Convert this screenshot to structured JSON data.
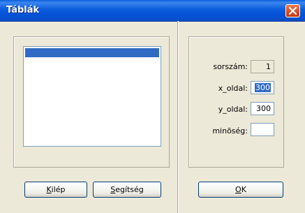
{
  "window": {
    "title": "Táblák",
    "close_icon": "close-icon"
  },
  "list": {
    "items": [
      ""
    ]
  },
  "form": {
    "sorszam": {
      "label": "sorszám:",
      "value": "1"
    },
    "x_oldal": {
      "label": "x_oldal:",
      "value": "300"
    },
    "y_oldal": {
      "label": "y_oldal:",
      "value": "300"
    },
    "minoseg": {
      "label": "minõség:",
      "value": ""
    }
  },
  "buttons": {
    "kilep": {
      "mnemonic": "K",
      "rest": "ilép"
    },
    "segitseg": {
      "mnemonic": "S",
      "rest": "egítség"
    },
    "ok": {
      "mnemonic": "O",
      "rest": "K"
    }
  },
  "colors": {
    "titlebar": "#0b5ddc",
    "selection": "#316ac5",
    "dialog_bg": "#ece9d8",
    "close": "#d84a22"
  }
}
